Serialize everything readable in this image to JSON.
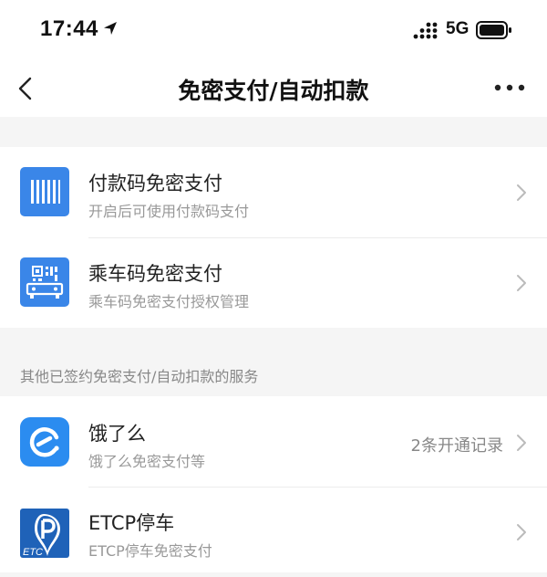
{
  "status": {
    "time": "17:44",
    "network": "5G",
    "icons": [
      "location-arrow-icon",
      "signal-icon",
      "battery-icon"
    ]
  },
  "nav": {
    "title": "免密支付/自动扣款",
    "icons": [
      "back-chevron-icon",
      "more-dots-icon"
    ]
  },
  "primary_items": [
    {
      "title": "付款码免密支付",
      "subtitle": "开启后可使用付款码支付",
      "icon": "barcode-icon"
    },
    {
      "title": "乘车码免密支付",
      "subtitle": "乘车码免密支付授权管理",
      "icon": "transit-code-icon"
    }
  ],
  "section_header": "其他已签约免密支付/自动扣款的服务",
  "service_items": [
    {
      "title": "饿了么",
      "subtitle": "饿了么免密支付等",
      "extra": "2条开通记录",
      "icon": "eleme-logo-icon"
    },
    {
      "title": "ETCP停车",
      "subtitle": "ETCP停车免密支付",
      "icon": "etcp-logo-icon"
    }
  ],
  "colors": {
    "accent_blue": "#3a86e8",
    "background": "#f5f5f5",
    "card": "#ffffff",
    "subtitle_gray": "#999999"
  }
}
